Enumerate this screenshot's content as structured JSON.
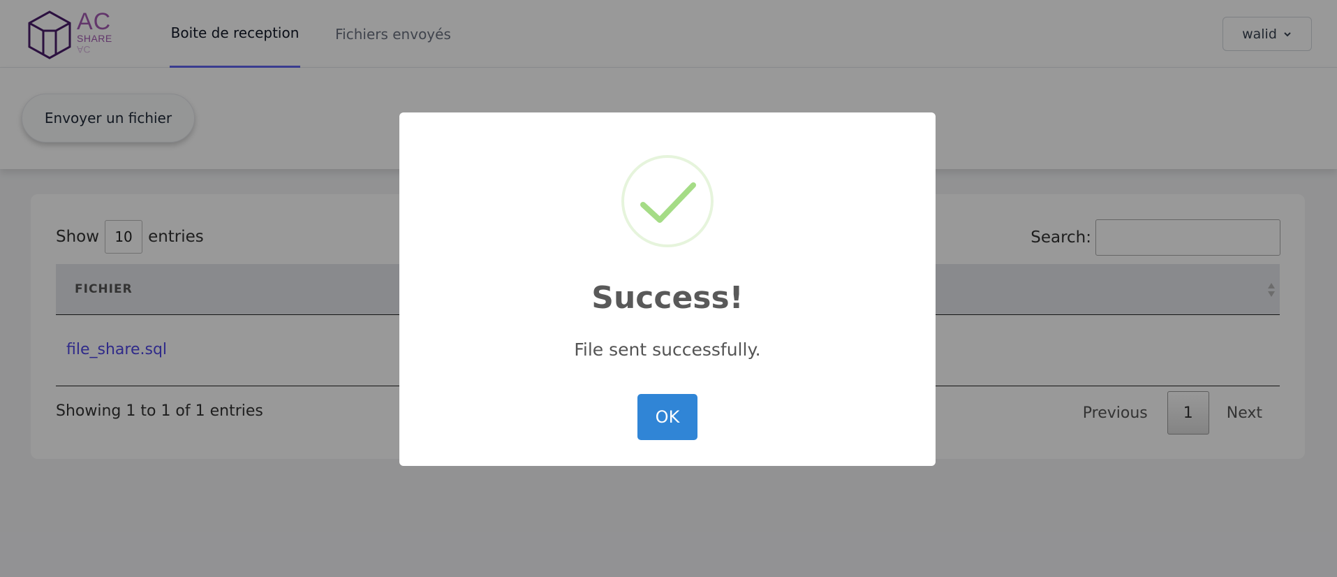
{
  "logo": {
    "line1": "AC",
    "line2": "SHARE",
    "reflection": "AC"
  },
  "nav": {
    "tabs": [
      {
        "label": "Boite de reception",
        "active": true
      },
      {
        "label": "Fichiers envoyés",
        "active": false
      }
    ],
    "user_label": "walid"
  },
  "header": {
    "send_button_label": "Envoyer un fichier"
  },
  "table": {
    "show_label": "Show",
    "page_length": "10",
    "entries_label": "entries",
    "search_label": "Search:",
    "search_value": "",
    "columns": [
      "FICHIER"
    ],
    "rows": [
      {
        "file": "file_share.sql"
      }
    ],
    "info": "Showing 1 to 1 of 1 entries",
    "pagination": {
      "previous": "Previous",
      "current_page": "1",
      "next": "Next"
    }
  },
  "modal": {
    "title": "Success!",
    "message": "File sent successfully.",
    "ok_label": "OK"
  },
  "colors": {
    "accent": "#6366f1",
    "logo": "#a35bb2",
    "ok_button": "#3085d6",
    "success": "#a5dc86",
    "link": "#4f46e5"
  }
}
